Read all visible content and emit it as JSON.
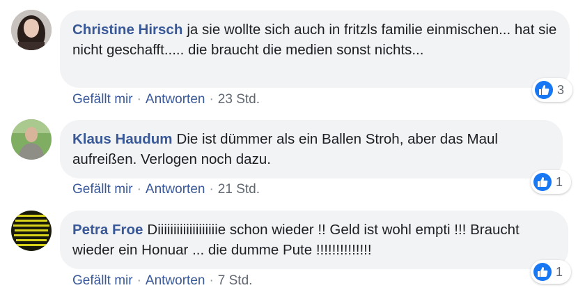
{
  "comments": [
    {
      "author": "Christine Hirsch",
      "text": "ja sie wollte sich auch in fritzls familie einmischen... hat sie nicht geschafft..... die braucht die medien sonst nichts...",
      "like_label": "Gefällt mir",
      "reply_label": "Antworten",
      "time": "23 Std.",
      "reaction_count": "3"
    },
    {
      "author": "Klaus Haudum",
      "text": "Die ist dümmer als ein Ballen Stroh, aber das Maul aufreißen. Verlogen noch dazu.",
      "like_label": "Gefällt mir",
      "reply_label": "Antworten",
      "time": "21 Std.",
      "reaction_count": "1"
    },
    {
      "author": "Petra Froe",
      "text": "Diiiiiiiiiiiiiiiiiiie schon wieder !! Geld ist wohl empti !!! Braucht wieder ein Honuar ... die dumme Pute !!!!!!!!!!!!!!",
      "like_label": "Gefällt mir",
      "reply_label": "Antworten",
      "time": "7 Std.",
      "reaction_count": "1"
    }
  ],
  "colors": {
    "author": "#385898",
    "bubble": "#f2f3f5",
    "like_badge": "#1877f2",
    "meta": "#606770"
  },
  "icons": {
    "reaction": "thumbs-up-icon"
  }
}
